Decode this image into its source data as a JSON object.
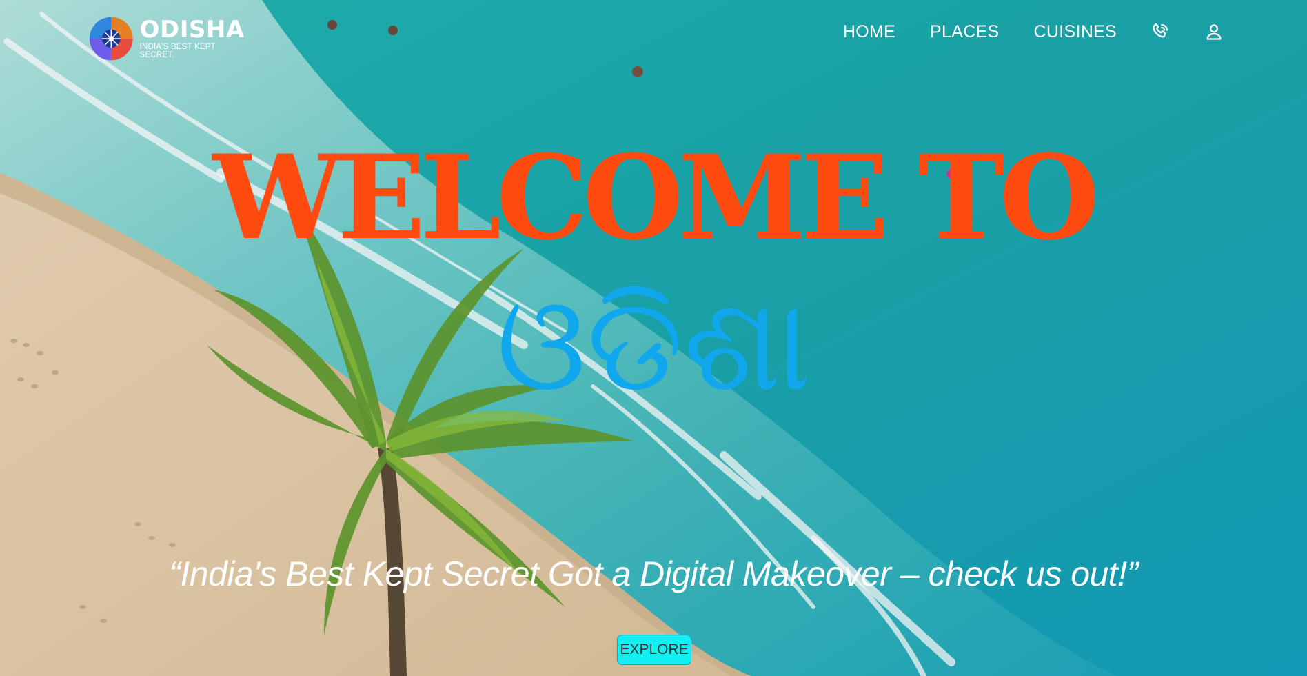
{
  "brand": {
    "name": "ODISHA",
    "tagline": "INDIA'S BEST KEPT SECRET."
  },
  "nav": {
    "links": [
      "HOME",
      "PLACES",
      "CUISINES"
    ],
    "icons": [
      "phone-icon",
      "user-icon"
    ]
  },
  "hero": {
    "welcome": "WELCOME TO",
    "title_odia": "ଓଡିଶା",
    "quote": "“India's Best Kept Secret Got a Digital Makeover – check us out!”",
    "cta_label": "EXPLORE"
  },
  "colors": {
    "welcome_text": "#ff4a10",
    "odia_text": "#11a7ec",
    "cta_background": "#12f0f4",
    "sea": "#1ba9ad",
    "sand": "#e6cfae"
  }
}
